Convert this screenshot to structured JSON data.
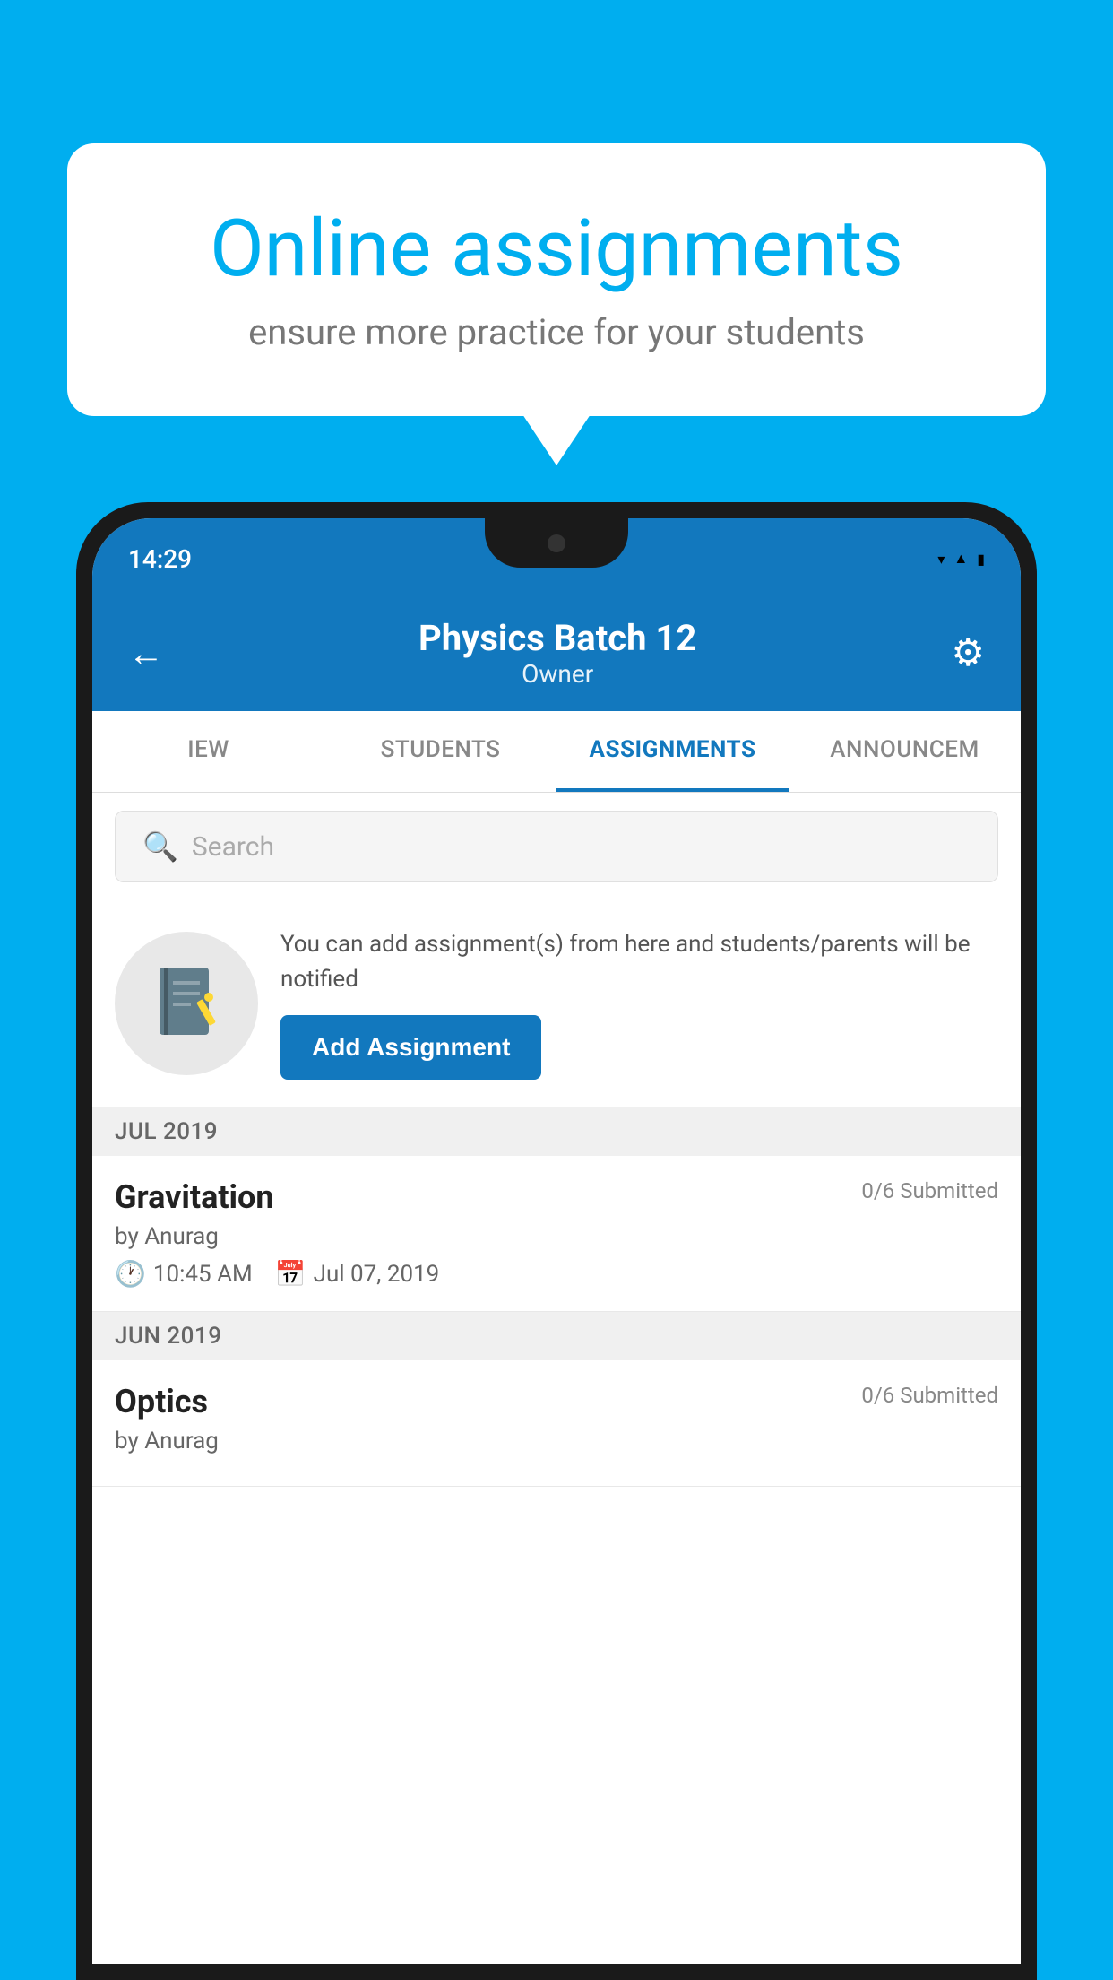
{
  "background": {
    "color": "#00AEEF"
  },
  "bubble": {
    "title": "Online assignments",
    "subtitle": "ensure more practice for your students"
  },
  "phone": {
    "status_bar": {
      "time": "14:29"
    },
    "header": {
      "title": "Physics Batch 12",
      "subtitle": "Owner"
    },
    "tabs": [
      {
        "label": "IEW",
        "active": false
      },
      {
        "label": "STUDENTS",
        "active": false
      },
      {
        "label": "ASSIGNMENTS",
        "active": true
      },
      {
        "label": "ANNOUNCEM",
        "active": false
      }
    ],
    "search": {
      "placeholder": "Search"
    },
    "promo": {
      "text": "You can add assignment(s) from here and students/parents will be notified",
      "button_label": "Add Assignment"
    },
    "sections": [
      {
        "month_label": "JUL 2019",
        "assignments": [
          {
            "title": "Gravitation",
            "submitted": "0/6 Submitted",
            "by": "by Anurag",
            "time": "10:45 AM",
            "date": "Jul 07, 2019"
          }
        ]
      },
      {
        "month_label": "JUN 2019",
        "assignments": [
          {
            "title": "Optics",
            "submitted": "0/6 Submitted",
            "by": "by Anurag",
            "time": "",
            "date": ""
          }
        ]
      }
    ]
  }
}
